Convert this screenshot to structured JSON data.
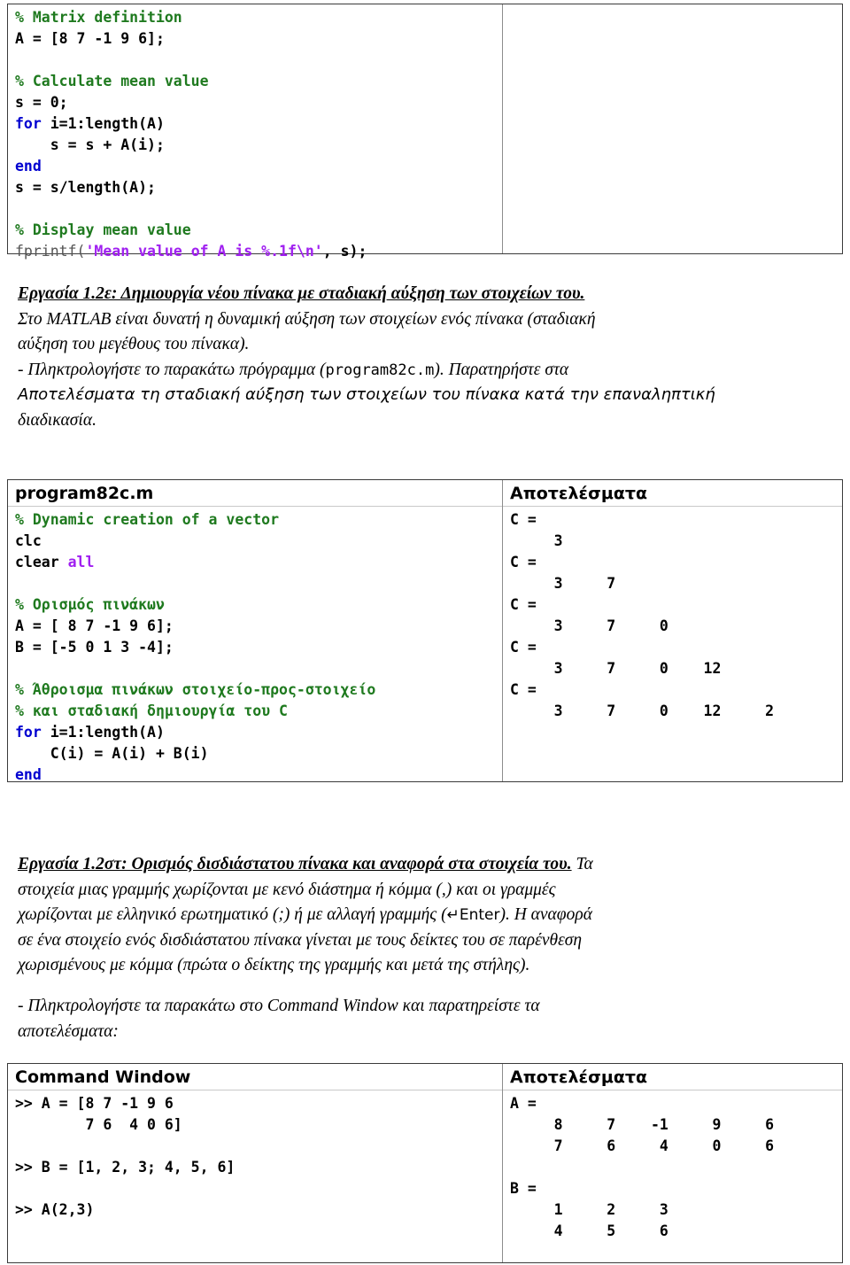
{
  "top_code_table": {
    "left_lines": [
      {
        "segs": [
          {
            "t": "% Matrix definition",
            "c": "cm"
          }
        ]
      },
      {
        "segs": [
          {
            "t": "A = [8 7 -1 9 6];",
            "c": "plain"
          }
        ]
      },
      {
        "segs": [
          {
            "t": "",
            "c": "plain"
          }
        ]
      },
      {
        "segs": [
          {
            "t": "% Calculate mean value",
            "c": "cm"
          }
        ]
      },
      {
        "segs": [
          {
            "t": "s = 0;",
            "c": "plain"
          }
        ]
      },
      {
        "segs": [
          {
            "t": "for",
            "c": "kw"
          },
          {
            "t": " i=1:length(A)",
            "c": "plain"
          }
        ]
      },
      {
        "segs": [
          {
            "t": "    s = s + A(i);",
            "c": "plain"
          }
        ]
      },
      {
        "segs": [
          {
            "t": "end",
            "c": "kw"
          }
        ]
      },
      {
        "segs": [
          {
            "t": "s = s/length(A);",
            "c": "plain"
          }
        ]
      },
      {
        "segs": [
          {
            "t": "",
            "c": "plain"
          }
        ]
      },
      {
        "segs": [
          {
            "t": "% Display mean value",
            "c": "cm"
          }
        ]
      },
      {
        "segs": [
          {
            "t": "fprintf(",
            "c": "light"
          },
          {
            "t": "'Mean value of A is %.1f\\n'",
            "c": "str"
          },
          {
            "t": ", s);",
            "c": "plain"
          }
        ]
      }
    ],
    "right_lines": []
  },
  "task_1_2e": {
    "heading": "Εργασία 1.2ε: Δημιουργία νέου πίνακα με σταδιακή αύξηση των στοιχείων του.",
    "line2": "Στο MATLAB είναι δυνατή η δυναμική αύξηση των στοιχείων ενός πίνακα (σταδιακή",
    "line3": "αύξηση του μεγέθους του πίνακα).",
    "line4_a": "- Πληκτρολογήστε το παρακάτω πρόγραμμα (",
    "line4_mono": "program82c.m",
    "line4_b": "). Παρατηρήστε στα",
    "line5": "Αποτελέσματα τη σταδιακή αύξηση των στοιχείων του πίνακα κατά την επαναληπτική",
    "line6": "διαδικασία."
  },
  "mid_table": {
    "left_title": "program82c.m",
    "right_title": "Αποτελέσματα",
    "left_lines": [
      {
        "segs": [
          {
            "t": "% Dynamic creation of a vector",
            "c": "cm"
          }
        ]
      },
      {
        "segs": [
          {
            "t": "clc",
            "c": "plain"
          }
        ]
      },
      {
        "segs": [
          {
            "t": "clear ",
            "c": "plain"
          },
          {
            "t": "all",
            "c": "str"
          }
        ]
      },
      {
        "segs": [
          {
            "t": "",
            "c": "plain"
          }
        ]
      },
      {
        "segs": [
          {
            "t": "% Ορισμός πινάκων",
            "c": "cm"
          }
        ]
      },
      {
        "segs": [
          {
            "t": "A = [ 8 7 -1 9 6];",
            "c": "plain"
          }
        ]
      },
      {
        "segs": [
          {
            "t": "B = [-5 0 1 3 -4];",
            "c": "plain"
          }
        ]
      },
      {
        "segs": [
          {
            "t": "",
            "c": "plain"
          }
        ]
      },
      {
        "segs": [
          {
            "t": "% Άθροισμα πινάκων στοιχείο-προς-στοιχείο",
            "c": "cm"
          }
        ]
      },
      {
        "segs": [
          {
            "t": "% και σταδιακή δημιουργία του C",
            "c": "cm"
          }
        ]
      },
      {
        "segs": [
          {
            "t": "for",
            "c": "kw"
          },
          {
            "t": " i=1:length(A)",
            "c": "plain"
          }
        ]
      },
      {
        "segs": [
          {
            "t": "    C(i) = A(i) + B(i)",
            "c": "plain"
          }
        ]
      },
      {
        "segs": [
          {
            "t": "end",
            "c": "kw"
          }
        ]
      }
    ],
    "right_lines": [
      "C =",
      "     3",
      "C =",
      "     3     7",
      "C =",
      "     3     7     0",
      "C =",
      "     3     7     0    12",
      "C =",
      "     3     7     0    12     2"
    ]
  },
  "task_1_2st": {
    "heading": "Εργασία 1.2στ: Ορισμός δισδιάστατου πίνακα και αναφορά στα στοιχεία του.",
    "line1_tail": " Τα",
    "line2": "στοιχεία μιας γραμμής χωρίζονται με κενό διάστημα ή κόμμα (,) και οι γραμμές",
    "line3_a": "χωρίζονται με ελληνικό ερωτηματικό (;) ή με αλλαγή γραμμής (",
    "line3_key": "↵Enter",
    "line3_b": "). Η αναφορά",
    "line4": "σε ένα στοιχείο ενός δισδιάστατου πίνακα γίνεται με τους δείκτες του σε παρένθεση",
    "line5": "χωρισμένους με κόμμα (πρώτα ο δείκτης της γραμμής και μετά της στήλης).",
    "instruction_line1": "- Πληκτρολογήστε  τα  παρακάτω  στο  Command  Window  και  παρατηρείστε  τα",
    "instruction_line2": "αποτελέσματα:"
  },
  "bottom_table": {
    "left_title": "Command Window",
    "right_title": "Αποτελέσματα",
    "left_lines": [
      ">> A = [8 7 -1 9 6",
      "        7 6  4 0 6]",
      "",
      ">> B = [1, 2, 3; 4, 5, 6]",
      "",
      ">> A(2,3)"
    ],
    "right_lines": [
      "A =",
      "     8     7    -1     9     6",
      "     7     6     4     0     6",
      "",
      "B =",
      "     1     2     3",
      "     4     5     6"
    ]
  },
  "colors": {
    "comment_green": "#1f7a1f",
    "keyword_blue": "#0000d0",
    "string_purple": "#a020f0",
    "border_dark": "#3a3a3a",
    "divider_gray": "#8c8c8c",
    "text_black": "#000000"
  }
}
